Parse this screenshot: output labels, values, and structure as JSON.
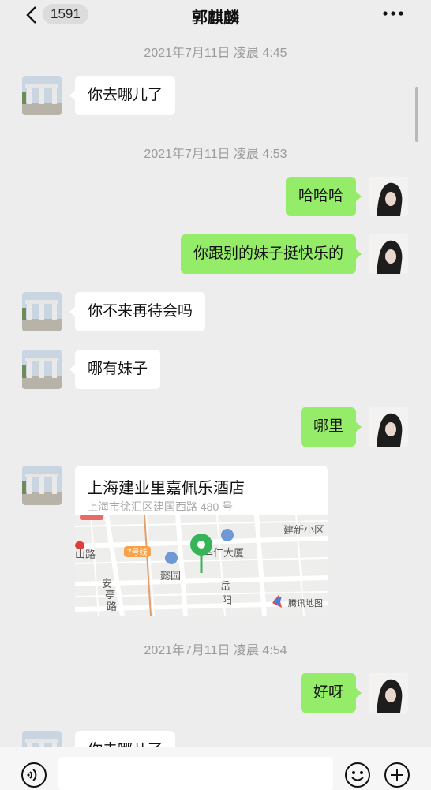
{
  "header": {
    "back_badge": "1591",
    "title": "郭麒麟"
  },
  "messages": {
    "t1": "2021年7月11日 凌晨 4:45",
    "m1": "你去哪儿了",
    "t2": "2021年7月11日 凌晨 4:53",
    "m2": "哈哈哈",
    "m3": "你跟别的妹子挺快乐的",
    "m4": "你不来再待会吗",
    "m5": "哪有妹子",
    "m6": "哪里",
    "t3": "2021年7月11日 凌晨 4:54",
    "m7": "好呀",
    "m8": "你去哪儿了"
  },
  "location": {
    "name": "上海建业里嘉佩乐酒店",
    "address": "上海市徐汇区建国西路 480 号",
    "map_labels": {
      "community": "建新小区",
      "road_left": "山路",
      "line7": "7号线",
      "building": "华仁大厦",
      "yiyuan": "懿园",
      "an": "安",
      "ting": "亭",
      "lu": "路",
      "yue": "岳",
      "yang": "阳",
      "provider": "腾讯地图"
    }
  },
  "colors": {
    "outgoing_bubble": "#95ec69",
    "incoming_bubble": "#ffffff",
    "background": "#ededed",
    "pin": "#35b558"
  }
}
